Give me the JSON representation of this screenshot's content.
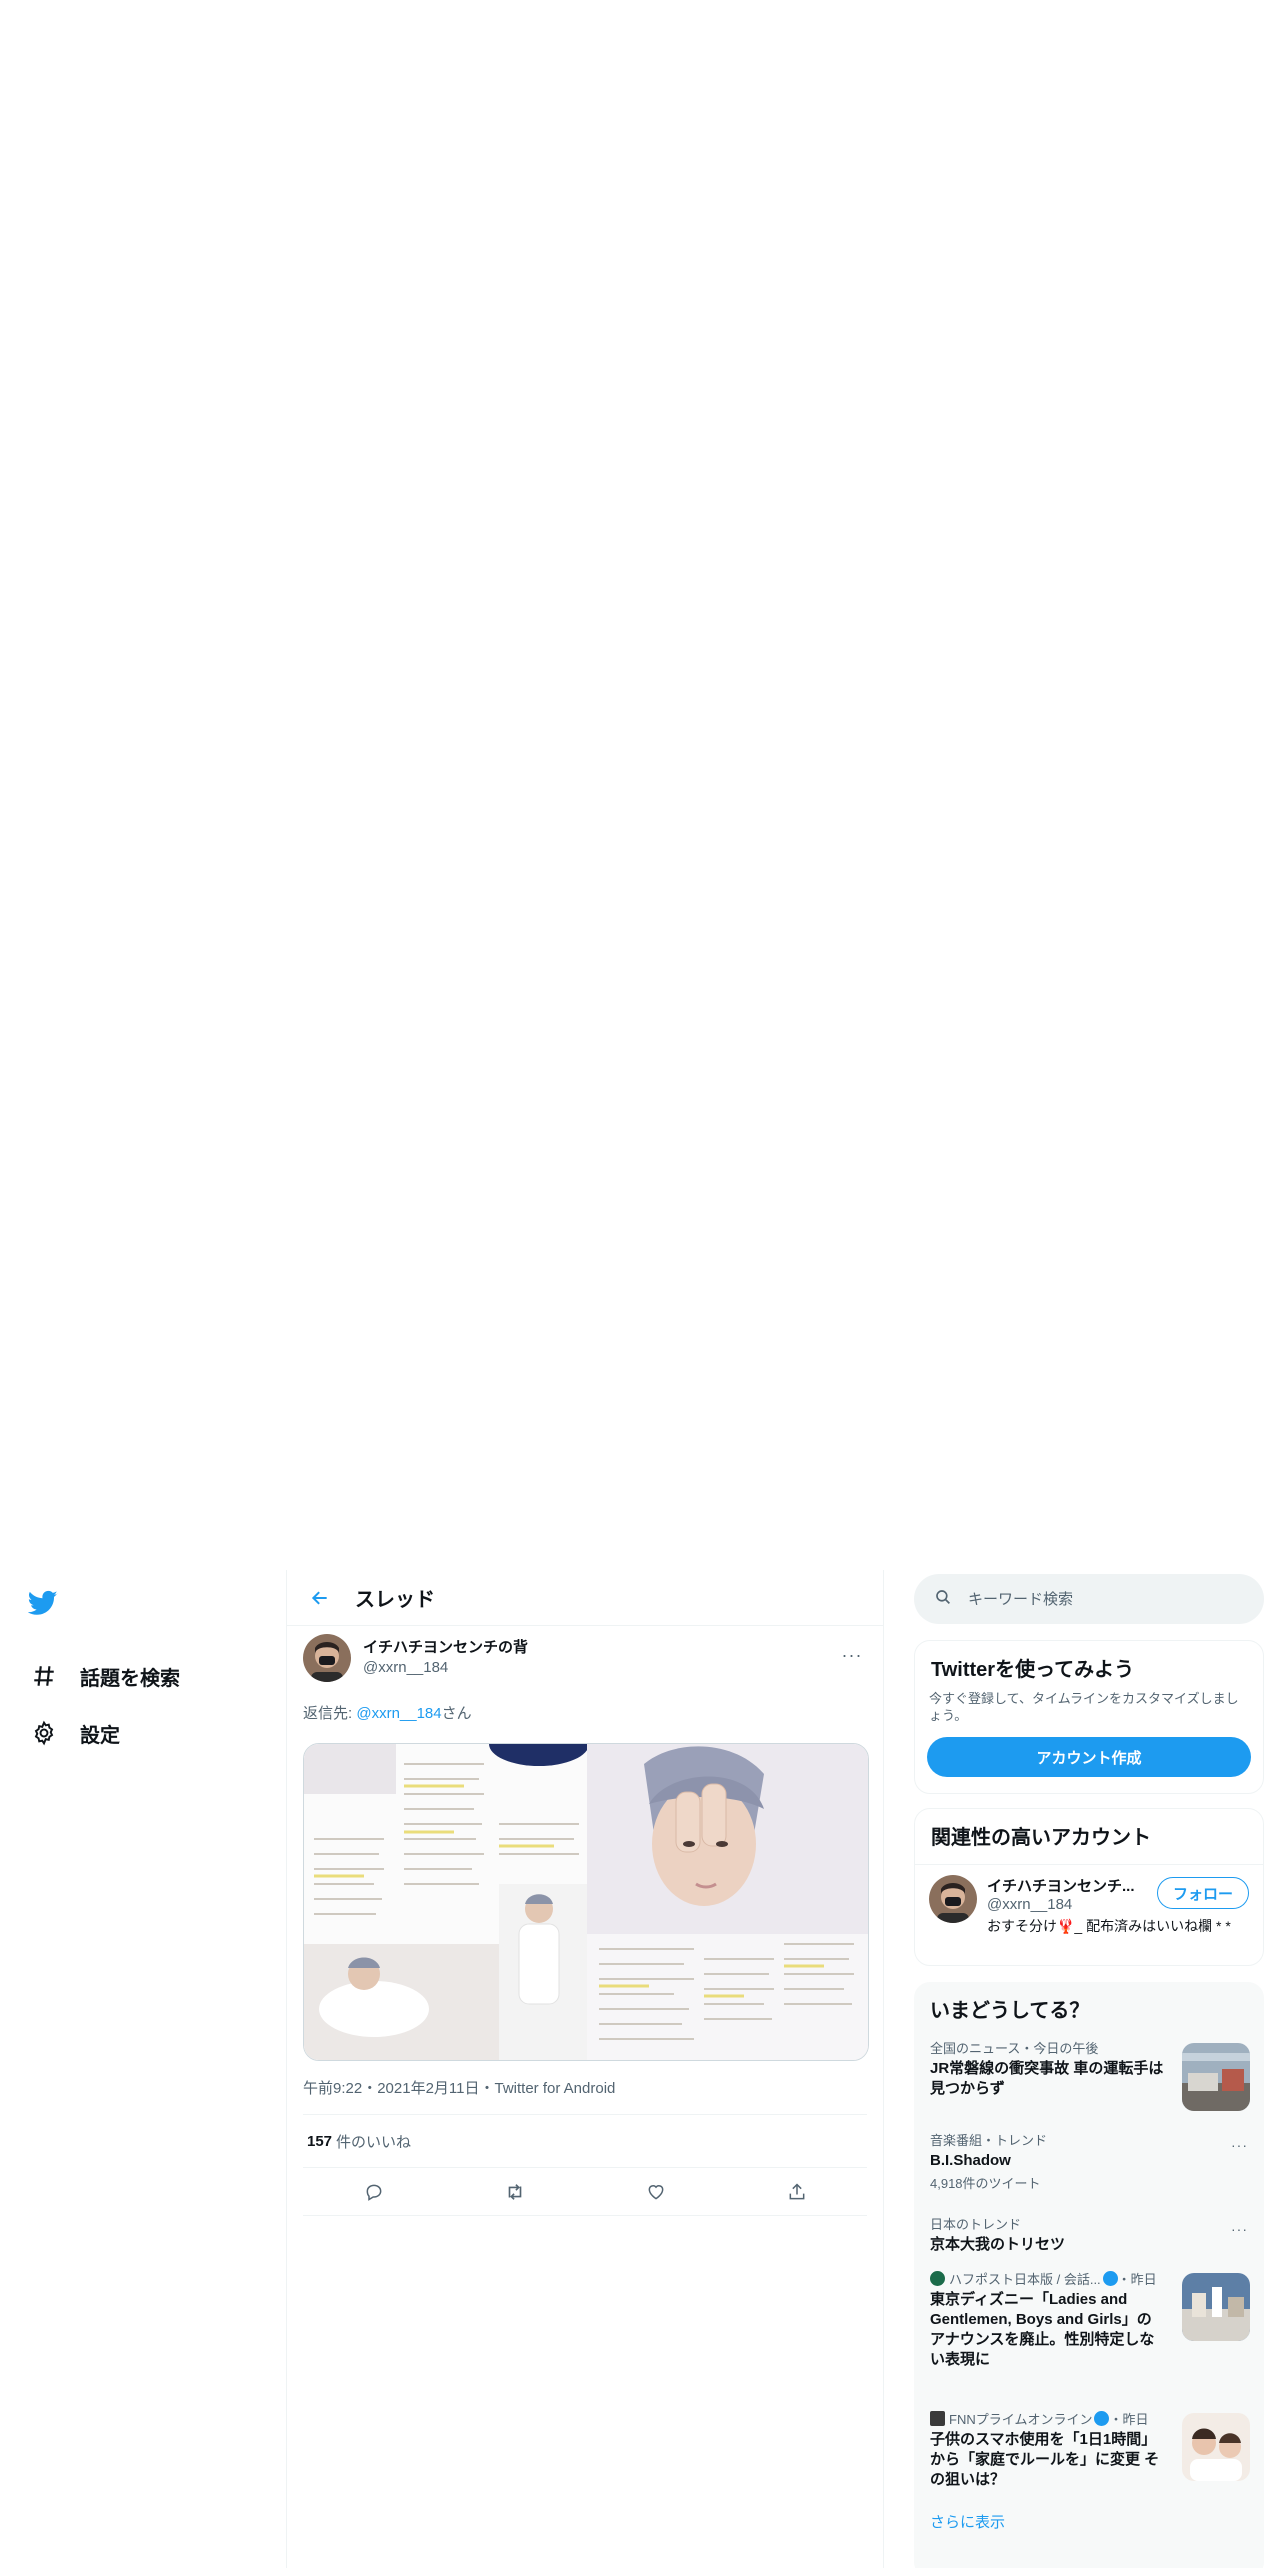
{
  "nav": {
    "items": [
      {
        "label": "話題を検索",
        "icon": "hashtag-icon"
      },
      {
        "label": "設定",
        "icon": "gear-icon"
      }
    ]
  },
  "header": {
    "title": "スレッド"
  },
  "tweet": {
    "display_name": "イチハチヨンセンチの背",
    "handle": "@xxrn__184",
    "reply_prefix": "返信先: ",
    "reply_handle": "@xxrn__184",
    "reply_suffix": "さん",
    "timestamp": "午前9:22・2021年2月11日・Twitter for Android",
    "likes_count": "157",
    "likes_label": "件のいいね",
    "media_text": "俺もあと少しで結婚できる年なのか〜！"
  },
  "search": {
    "placeholder": "キーワード検索"
  },
  "signup": {
    "title": "Twitterを使ってみよう",
    "description": "今すぐ登録して、タイムラインをカスタマイズしましょう。",
    "button": "アカウント作成"
  },
  "related": {
    "title": "関連性の高いアカウント",
    "user": {
      "display_name": "イチハチヨンセンチ...",
      "handle": "@xxrn__184",
      "bio": "おすそ分け🦞_ 配布済みはいいね欄 * *",
      "follow": "フォロー"
    }
  },
  "trends": {
    "title": "いまどうしてる？",
    "items": [
      {
        "context": "全国のニュース・今日の午後",
        "name": "JR常磐線の衝突事故 車の運転手は見つからず"
      },
      {
        "context": "音楽番組・トレンド",
        "name": "B.I.Shadow",
        "count": "4,918件のツイート"
      },
      {
        "context": "日本のトレンド",
        "name": "京本大我のトリセツ"
      },
      {
        "source": "ハフポスト日本版 / 会話...",
        "time": "・昨日",
        "name": "東京ディズニー「Ladies and Gentlemen, Boys and Girls」のアナウンスを廃止。性別特定しない表現に"
      },
      {
        "source": "FNNプライムオンライン",
        "time": "・昨日",
        "name": "子供のスマホ使用を「1日1時間」から「家庭でルールを」に変更 その狙いは？"
      }
    ],
    "show_more": "さらに表示"
  },
  "colors": {
    "accent": "#1d9bf0",
    "text": "#0f1419",
    "muted": "#536471",
    "border": "#eff3f4"
  }
}
